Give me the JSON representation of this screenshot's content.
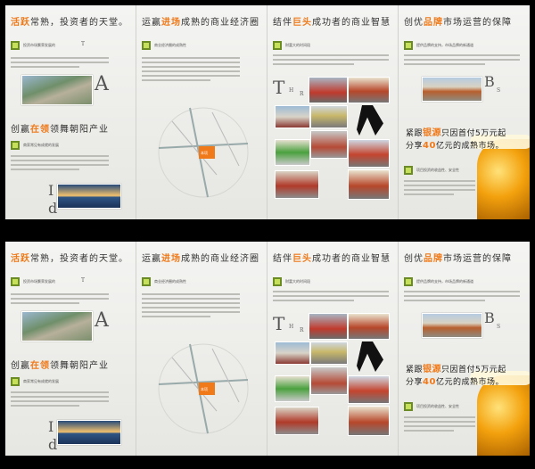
{
  "panels": {
    "p1": {
      "heading_hl": "活跃",
      "heading_rest": "常熟，投资者的天堂。",
      "sub1_hl": "创赢",
      "sub1_hl2": "在领",
      "sub1_rest": "领舞朝阳产业",
      "cap1": "投资市场繁荣发展的",
      "cap1_letter": "T",
      "cap2": "商家常见有成就的发展",
      "letterA": "A",
      "letterI": "I",
      "letterD": "d"
    },
    "p2": {
      "heading_hl": "运赢",
      "heading_hl2": "进场",
      "heading_rest": "成熟的商业经济圈",
      "cap1": "商业经济圈的成熟性",
      "map_label": "本项"
    },
    "p3": {
      "heading_pre": "结伴",
      "heading_hl": "巨头",
      "heading_rest": "成功者的商业智慧",
      "cap1": "财富大的时间段",
      "letterT": "T",
      "letterH": "H",
      "letterR": "R"
    },
    "p4": {
      "heading_pre": "创优",
      "heading_hl": "品牌",
      "heading_rest": "市场运营的保障",
      "cap1": "提供品牌的支持，市场品牌的新通道",
      "letterB": "B",
      "letterS": "S",
      "promo1_pre": "紧跟",
      "promo1_hl": "银源",
      "promo1_rest": "只因首付5万元起",
      "promo2_pre": "分享",
      "promo2_hl": "40",
      "promo2_rest": "亿元的成熟市场。",
      "cap2": "项目投资的收益性、安全性"
    }
  },
  "colors": {
    "accent": "#f07a1a",
    "tag_dark": "#6b8c25",
    "tag_light": "#c6e05b",
    "background": "#000000"
  }
}
